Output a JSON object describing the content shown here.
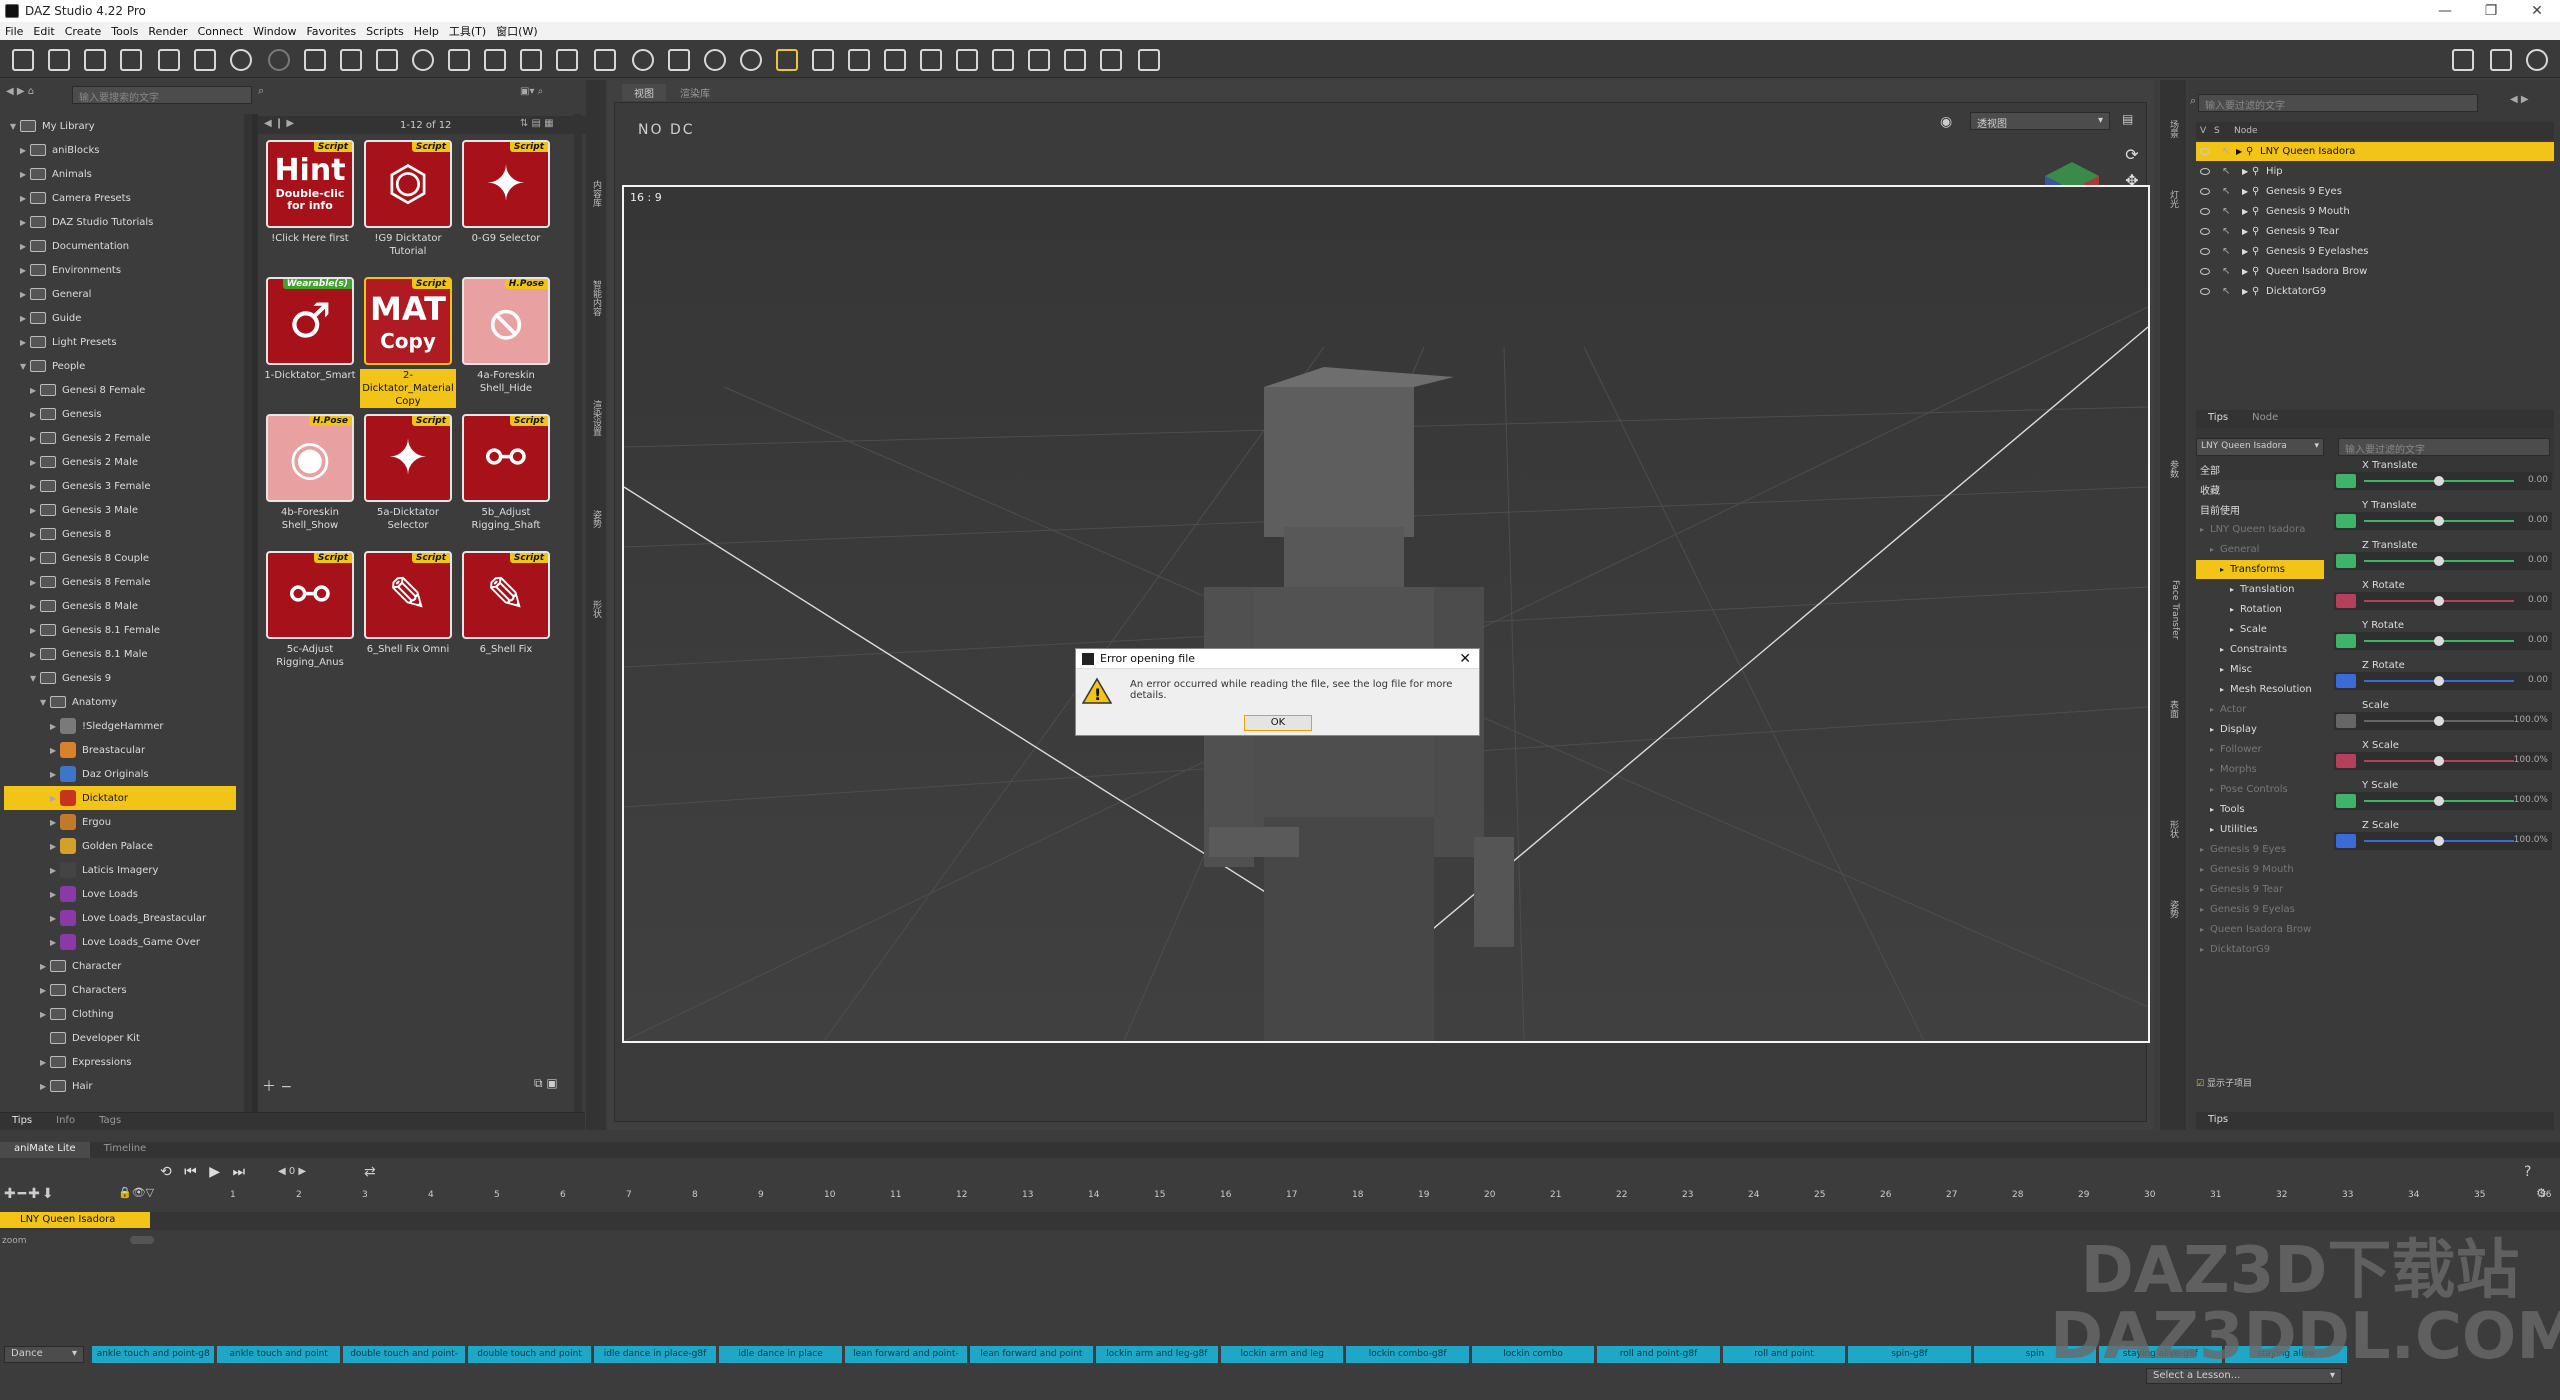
{
  "window": {
    "title": "DAZ Studio 4.22 Pro",
    "controls": [
      "—",
      "❐",
      "✕"
    ]
  },
  "menu": [
    "File",
    "Edit",
    "Create",
    "Tools",
    "Render",
    "Connect",
    "Window",
    "Favorites",
    "Scripts",
    "Help",
    "工具(T)",
    "窗口(W)"
  ],
  "library": {
    "search_placeholder": "输入要搜索的文字",
    "page_info": "1-12 of 12",
    "tree": [
      {
        "label": "My Library",
        "level": 0,
        "open": true
      },
      {
        "label": "aniBlocks",
        "level": 1
      },
      {
        "label": "Animals",
        "level": 1
      },
      {
        "label": "Camera Presets",
        "level": 1
      },
      {
        "label": "DAZ Studio Tutorials",
        "level": 1
      },
      {
        "label": "Documentation",
        "level": 1
      },
      {
        "label": "Environments",
        "level": 1
      },
      {
        "label": "General",
        "level": 1
      },
      {
        "label": "Guide",
        "level": 1
      },
      {
        "label": "Light Presets",
        "level": 1
      },
      {
        "label": "People",
        "level": 1,
        "open": true
      },
      {
        "label": "Genesi 8 Female",
        "level": 2
      },
      {
        "label": "Genesis",
        "level": 2
      },
      {
        "label": "Genesis 2 Female",
        "level": 2
      },
      {
        "label": "Genesis 2 Male",
        "level": 2
      },
      {
        "label": "Genesis 3 Female",
        "level": 2
      },
      {
        "label": "Genesis 3 Male",
        "level": 2
      },
      {
        "label": "Genesis 8",
        "level": 2
      },
      {
        "label": "Genesis 8 Couple",
        "level": 2
      },
      {
        "label": "Genesis 8 Female",
        "level": 2
      },
      {
        "label": "Genesis 8 Male",
        "level": 2
      },
      {
        "label": "Genesis 8.1 Female",
        "level": 2
      },
      {
        "label": "Genesis 8.1 Male",
        "level": 2
      },
      {
        "label": "Genesis 9",
        "level": 2,
        "open": true
      },
      {
        "label": "Anatomy",
        "level": 3,
        "open": true
      },
      {
        "label": "!SledgeHammer",
        "level": 4,
        "icon": "#7a7a7a"
      },
      {
        "label": "Breastacular",
        "level": 4,
        "icon": "#d9822b"
      },
      {
        "label": "Daz Originals",
        "level": 4,
        "icon": "#3d76c6"
      },
      {
        "label": "Dicktator",
        "level": 4,
        "icon": "#c8331f",
        "selected": true
      },
      {
        "label": "Ergou",
        "level": 4,
        "icon": "#c07a2a"
      },
      {
        "label": "Golden Palace",
        "level": 4,
        "icon": "#d3a02a"
      },
      {
        "label": "Laticis Imagery",
        "level": 4,
        "icon": "#444"
      },
      {
        "label": "Love Loads",
        "level": 4,
        "icon": "#8a3aa6"
      },
      {
        "label": "Love Loads_Breastacular",
        "level": 4,
        "icon": "#8a3aa6"
      },
      {
        "label": "Love Loads_Game Over",
        "level": 4,
        "icon": "#8a3aa6"
      },
      {
        "label": "Character",
        "level": 3
      },
      {
        "label": "Characters",
        "level": 3
      },
      {
        "label": "Clothing",
        "level": 3
      },
      {
        "label": "Developer Kit",
        "level": 3,
        "noarrow": true
      },
      {
        "label": "Expressions",
        "level": 3
      },
      {
        "label": "Hair",
        "level": 3
      }
    ],
    "items": [
      {
        "label": "!Click Here first",
        "badge": "Script",
        "art": "Hint\nDouble-clic\nfor info",
        "kind": "hint"
      },
      {
        "label": "!G9 Dicktator Tutorial",
        "badge": "Script",
        "art": "pdf-icon",
        "kind": "pdf"
      },
      {
        "label": "0-G9 Selector",
        "badge": "Script",
        "art": "wand-icon",
        "kind": "wand"
      },
      {
        "label": "1-Dicktator_Smart",
        "badge": "Wearable(s)",
        "badgeColor": "green",
        "art": "male-icon",
        "kind": "male"
      },
      {
        "label": "2-Dicktator_Material Copy",
        "badge": "Script",
        "art": "MAT\nCopy",
        "kind": "mat",
        "selected": true
      },
      {
        "label": "4a-Foreskin Shell_Hide",
        "badge": "H.Pose",
        "art": "hide-icon",
        "kind": "hide"
      },
      {
        "label": "4b-Foreskin Shell_Show",
        "badge": "H.Pose",
        "art": "show-icon",
        "kind": "show"
      },
      {
        "label": "5a-Dicktator Selector",
        "badge": "Script",
        "art": "wand-icon",
        "kind": "wand"
      },
      {
        "label": "5b_Adjust Rigging_Shaft",
        "badge": "Script",
        "art": "bone-icon",
        "kind": "bone"
      },
      {
        "label": "5c-Adjust Rigging_Anus",
        "badge": "Script",
        "art": "bone-icon",
        "kind": "bone"
      },
      {
        "label": "6_Shell Fix Omni",
        "badge": "Script",
        "art": "brush-icon",
        "kind": "brush"
      },
      {
        "label": "6_Shell Fix",
        "badge": "Script",
        "art": "brush-icon",
        "kind": "brush"
      }
    ],
    "bottom_tabs": [
      "Tips",
      "Info",
      "Tags"
    ]
  },
  "viewport": {
    "tabs": [
      "视图",
      "渲染库"
    ],
    "camera": "透视图",
    "overlay_text": "NO DC",
    "aspect": "16 : 9"
  },
  "dialog": {
    "title": "Error opening file",
    "message": "An error occurred while reading the file, see the log file for more details.",
    "ok": "OK"
  },
  "scene": {
    "search_placeholder": "输入要过滤的文字",
    "header": [
      "V",
      "S",
      "Node"
    ],
    "nodes": [
      {
        "label": "LNY Queen Isadora",
        "selected": true,
        "level": 0
      },
      {
        "label": "Hip",
        "level": 1
      },
      {
        "label": "Genesis 9 Eyes",
        "level": 1
      },
      {
        "label": "Genesis 9 Mouth",
        "level": 1
      },
      {
        "label": "Genesis 9 Tear",
        "level": 1
      },
      {
        "label": "Genesis 9 Eyelashes",
        "level": 1
      },
      {
        "label": "Queen Isadora Brow",
        "level": 1
      },
      {
        "label": "DicktatorG9",
        "level": 1
      }
    ],
    "tabs": [
      "Tips",
      "Node"
    ]
  },
  "params": {
    "node_select": "LNY Queen Isadora",
    "filter_placeholder": "输入要过滤的文字",
    "groups": [
      {
        "label": "全部"
      },
      {
        "label": "收藏"
      },
      {
        "label": "目前使用"
      },
      {
        "label": "LNY Queen Isadora",
        "dim": true
      },
      {
        "label": "General",
        "dim": true,
        "level": 1
      },
      {
        "label": "Transforms",
        "level": 2,
        "selected": true
      },
      {
        "label": "Translation",
        "level": 3
      },
      {
        "label": "Rotation",
        "level": 3
      },
      {
        "label": "Scale",
        "level": 3
      },
      {
        "label": "Constraints",
        "level": 2
      },
      {
        "label": "Misc",
        "level": 2
      },
      {
        "label": "Mesh Resolution",
        "level": 2
      },
      {
        "label": "Actor",
        "dim": true,
        "level": 1
      },
      {
        "label": "Display",
        "level": 1
      },
      {
        "label": "Follower",
        "dim": true,
        "level": 1
      },
      {
        "label": "Morphs",
        "dim": true,
        "level": 1
      },
      {
        "label": "Pose Controls",
        "dim": true,
        "level": 1
      },
      {
        "label": "Tools",
        "level": 1
      },
      {
        "label": "Utilities",
        "level": 1
      },
      {
        "label": "Genesis 9 Eyes",
        "dim": true
      },
      {
        "label": "Genesis 9 Mouth",
        "dim": true
      },
      {
        "label": "Genesis 9 Tear",
        "dim": true
      },
      {
        "label": "Genesis 9 Eyelas",
        "dim": true
      },
      {
        "label": "Queen Isadora Brow",
        "dim": true
      },
      {
        "label": "DicktatorG9",
        "dim": true
      }
    ],
    "sliders": [
      {
        "label": "X Translate",
        "value": "0.00",
        "color": "#3db46a"
      },
      {
        "label": "Y Translate",
        "value": "0.00",
        "color": "#3db46a"
      },
      {
        "label": "Z Translate",
        "value": "0.00",
        "color": "#3db46a"
      },
      {
        "label": "X Rotate",
        "value": "0.00",
        "color": "#b4405a"
      },
      {
        "label": "Y Rotate",
        "value": "0.00",
        "color": "#3db46a"
      },
      {
        "label": "Z Rotate",
        "value": "0.00",
        "color": "#3b6bd6"
      },
      {
        "label": "Scale",
        "value": "100.0%",
        "color": "#666"
      },
      {
        "label": "X Scale",
        "value": "100.0%",
        "color": "#b4405a"
      },
      {
        "label": "Y Scale",
        "value": "100.0%",
        "color": "#3db46a"
      },
      {
        "label": "Z Scale",
        "value": "100.0%",
        "color": "#3b6bd6"
      }
    ],
    "show_sub_items": "显示子项目",
    "bottom_tab": "Tips"
  },
  "timeline": {
    "tabs": [
      "aniMate Lite",
      "Timeline"
    ],
    "frame": "0",
    "track": "LNY Queen Isadora",
    "zoom_label": "zoom",
    "ruler": [
      "1",
      "2",
      "3",
      "4",
      "5",
      "6",
      "7",
      "8",
      "9",
      "10",
      "11",
      "12",
      "13",
      "14",
      "15",
      "16",
      "17",
      "18",
      "19",
      "20",
      "21",
      "22",
      "23",
      "24",
      "25",
      "26",
      "27",
      "28",
      "29",
      "30",
      "31",
      "32",
      "33",
      "34",
      "35",
      "36"
    ],
    "category": "Dance",
    "clips": [
      "ankle touch and point-g8",
      "ankle touch and point",
      "double touch and point-",
      "double touch and point",
      "idle dance in place-g8f",
      "idle dance in place",
      "lean forward and point-",
      "lean forward and point",
      "lockin arm and leg-g8f",
      "lockin arm and leg",
      "lockin combo-g8f",
      "lockin combo",
      "roll and point-g8f",
      "roll and point",
      "spin-g8f",
      "spin",
      "staying alive-g8f",
      "staying alive"
    ],
    "lesson": "Select a Lesson..."
  },
  "watermark": [
    "DAZ3D下载站",
    "DAZ3DDL.COM"
  ]
}
